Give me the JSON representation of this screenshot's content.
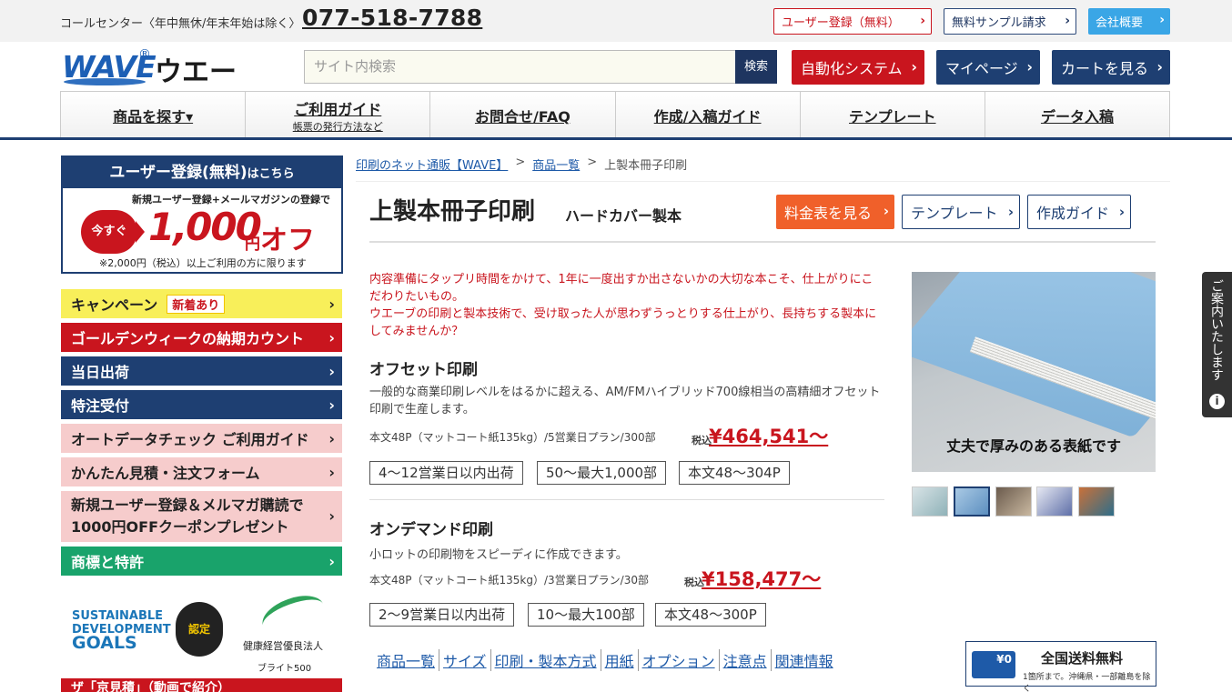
{
  "topbar": {
    "callcenter": "コールセンター〈年中無休/年末年始は除く〉",
    "phone": "077-518-7788",
    "register_label": "ユーザー登録（無料）",
    "sample_label": "無料サンプル請求",
    "company_label": "会社概要"
  },
  "header": {
    "logo_wave": "WAVE",
    "logo_reg": "®",
    "logo_kana": "ウエーブ",
    "search_placeholder": "サイト内検索",
    "search_button": "検索",
    "auto_label": "自動化システム",
    "mypage_label": "マイページ",
    "cart_label": "カートを見る"
  },
  "nav": {
    "items": [
      {
        "label": "商品を探す▾"
      },
      {
        "label": "ご利用ガイド",
        "sub": "帳票の発行方法など"
      },
      {
        "label": "お問合せ/FAQ"
      },
      {
        "label": "作成/入稿ガイド"
      },
      {
        "label": "テンプレート"
      },
      {
        "label": "データ入稿"
      }
    ]
  },
  "banner": {
    "head": "ユーザー登録",
    "head_free": "(無料)",
    "head_tail": "はこちら",
    "note": "新規ユーザー登録+メールマガジンの登録で",
    "now": "今すぐ",
    "amount": "1,000",
    "off_unit": "円",
    "off": "オフ",
    "condition": "※2,000円（税込）以上ご利用の方に限ります"
  },
  "sidebar": {
    "campaign": "キャンペーン",
    "campaign_tag": "新着あり",
    "gw": "ゴールデンウィークの納期カウント",
    "same_day": "当日出荷",
    "special": "特注受付",
    "auto_check": "オートデータチェック ご利用ガイド",
    "estimate": "かんたん見積・注文フォーム",
    "coupon_line1": "新規ユーザー登録＆メルマガ購読で",
    "coupon_line2": "1000円OFFクーポンプレゼント",
    "trademark": "商標と特許",
    "sdg_line1": "SUSTAINABLE",
    "sdg_line2": "DEVELOPMENT",
    "sdg_line3": "GOALS",
    "sdg_badge": "認定",
    "health_title": "健康経営優良法人",
    "health_sub": "ブライト500",
    "video": "ザ「京見積」（動画で紹介）"
  },
  "breadcrumb": {
    "home": "印刷のネット通販【WAVE】",
    "list": "商品一覧",
    "current": "上製本冊子印刷",
    "sep": ">"
  },
  "product": {
    "title": "上製本冊子印刷",
    "subtitle": "ハードカバー製本",
    "price_button": "料金表を見る",
    "template_button": "テンプレート",
    "guide_button": "作成ガイド",
    "intro": "内容準備にタップリ時間をかけて、1年に一度出すか出さないかの大切な本こそ、仕上がりにこだわりたいもの。\nウエーブの印刷と製本技術で、受け取った人が思わずうっとりする仕上がり、長持ちする製本にしてみませんか？",
    "offset": {
      "title": "オフセット印刷",
      "desc": "一般的な商業印刷レベルをはるかに超える、AM/FMハイブリッド700線相当の高精細オフセット印刷で生産します。",
      "spec": "本文48P（マットコート紙135kg）/5営業日プラン/300部",
      "price_label": "税込",
      "price": "¥464,541～",
      "tags": [
        "4～12営業日以内出荷",
        "50～最大1,000部",
        "本文48～304P"
      ]
    },
    "ondemand": {
      "title": "オンデマンド印刷",
      "desc": "小ロットの印刷物をスピーディに作成できます。",
      "spec": "本文48P（マットコート紙135kg）/3営業日プラン/30部",
      "price_label": "税込",
      "price": "¥158,477～",
      "tags": [
        "2～9営業日以内出荷",
        "10～最大100部",
        "本文48～300P"
      ]
    },
    "subnav": [
      "商品一覧",
      "サイズ",
      "印刷・製本方式",
      "用紙",
      "オプション",
      "注意点",
      "関連情報"
    ],
    "photo_caption": "丈夫で厚みのある表紙です"
  },
  "shipping": {
    "badge": "¥0",
    "title": "全国送料無料",
    "note": "1箇所まで。沖縄県・一部離島を除く"
  },
  "help": {
    "text": "ご案内いたします",
    "icon": "i"
  }
}
